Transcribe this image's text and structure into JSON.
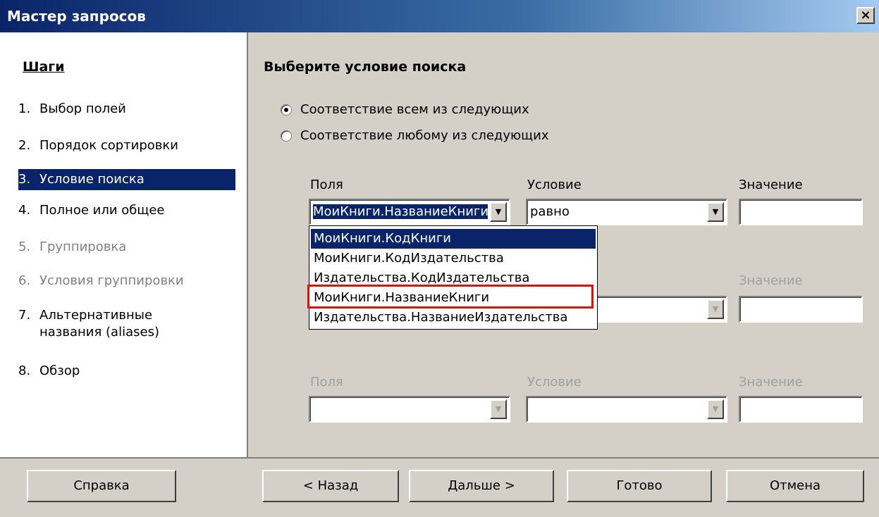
{
  "window": {
    "title": "Мастер запросов",
    "close_label": "×"
  },
  "sidebar": {
    "heading": "Шаги",
    "steps": [
      {
        "num": "1.",
        "label": "Выбор полей"
      },
      {
        "num": "2.",
        "label": "Порядок сортировки"
      },
      {
        "num": "3.",
        "label": "Условие поиска"
      },
      {
        "num": "4.",
        "label": "Полное или общее"
      },
      {
        "num": "5.",
        "label": "Группировка"
      },
      {
        "num": "6.",
        "label": "Условия группировки"
      },
      {
        "num": "7.",
        "label": "Альтернативные названия (aliases)"
      },
      {
        "num": "8.",
        "label": "Обзор"
      }
    ]
  },
  "main": {
    "title": "Выберите условие поиска",
    "radio_all": "Соответствие всем из следующих",
    "radio_any": "Соответствие любому из следующих",
    "row1": {
      "fields_label": "Поля",
      "condition_label": "Условие",
      "value_label": "Значение",
      "fields_value": "МоиКниги.НазваниеКниги",
      "condition_value": "равно",
      "value": ""
    },
    "row2": {
      "value_label": "Значение",
      "value": ""
    },
    "row3": {
      "fields_label": "Поля",
      "condition_label": "Условие",
      "value_label": "Значение",
      "fields_value": "",
      "condition_value": "",
      "value": ""
    },
    "dropdown_options": [
      "МоиКниги.КодКниги",
      "МоиКниги.КодИздательства",
      "Издательства.КодИздательства",
      "МоиКниги.НазваниеКниги",
      "Издательства.НазваниеИздательства"
    ]
  },
  "buttons": {
    "help": "Справка",
    "back": "< Назад",
    "next": "Дальше >",
    "finish": "Готово",
    "cancel": "Отмена"
  },
  "colors": {
    "selection": "#0a246a",
    "highlight_border": "#e01010",
    "dialog_bg": "#d4d0c8"
  }
}
